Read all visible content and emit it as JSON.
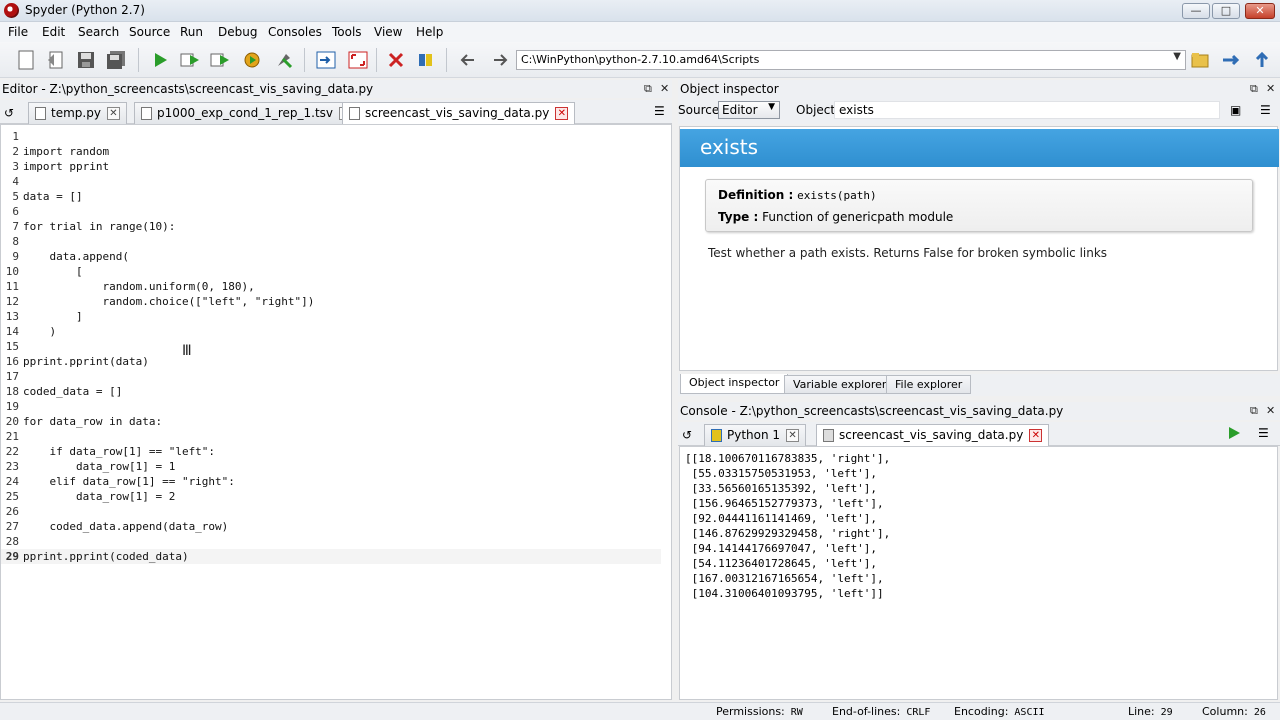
{
  "window": {
    "title": "Spyder (Python 2.7)"
  },
  "menu": [
    "File",
    "Edit",
    "Search",
    "Source",
    "Run",
    "Debug",
    "Consoles",
    "Tools",
    "View",
    "Help"
  ],
  "toolbar": {
    "path": "C:\\WinPython\\python-2.7.10.amd64\\Scripts"
  },
  "editor": {
    "header": "Editor - Z:\\python_screencasts\\screencast_vis_saving_data.py",
    "tabs": [
      "temp.py",
      "p1000_exp_cond_1_rep_1.tsv",
      "screencast_vis_saving_data.py"
    ],
    "active_tab": 2,
    "lines": [
      {
        "n": "1",
        "text": ""
      },
      {
        "n": "2",
        "text": "import random"
      },
      {
        "n": "3",
        "text": "import pprint"
      },
      {
        "n": "4",
        "text": ""
      },
      {
        "n": "5",
        "text": "data = []"
      },
      {
        "n": "6",
        "text": ""
      },
      {
        "n": "7",
        "text": "for trial in range(10):"
      },
      {
        "n": "8",
        "text": ""
      },
      {
        "n": "9",
        "text": "    data.append("
      },
      {
        "n": "10",
        "text": "        ["
      },
      {
        "n": "11",
        "text": "            random.uniform(0, 180),"
      },
      {
        "n": "12",
        "text": "            random.choice([\"left\", \"right\"])"
      },
      {
        "n": "13",
        "text": "        ]"
      },
      {
        "n": "14",
        "text": "    )"
      },
      {
        "n": "15",
        "text": ""
      },
      {
        "n": "16",
        "text": "pprint.pprint(data)"
      },
      {
        "n": "17",
        "text": ""
      },
      {
        "n": "18",
        "text": "coded_data = []"
      },
      {
        "n": "19",
        "text": ""
      },
      {
        "n": "20",
        "text": "for data_row in data:"
      },
      {
        "n": "21",
        "text": ""
      },
      {
        "n": "22",
        "text": "    if data_row[1] == \"left\":"
      },
      {
        "n": "23",
        "text": "        data_row[1] = 1"
      },
      {
        "n": "24",
        "text": "    elif data_row[1] == \"right\":"
      },
      {
        "n": "25",
        "text": "        data_row[1] = 2"
      },
      {
        "n": "26",
        "text": ""
      },
      {
        "n": "27",
        "text": "    coded_data.append(data_row)"
      },
      {
        "n": "28",
        "text": ""
      },
      {
        "n": "29",
        "text": "pprint.pprint(coded_data)"
      }
    ]
  },
  "inspector": {
    "header": "Object inspector",
    "source_label": "Source",
    "source_value": "Editor",
    "object_label": "Object",
    "object_value": "exists",
    "title": "exists",
    "def_label": "Definition :",
    "def_value": "exists(path)",
    "type_label": "Type :",
    "type_value": "Function of genericpath module",
    "description": "Test whether a path exists. Returns False for broken symbolic links",
    "bottom_tabs": [
      "Object inspector",
      "Variable explorer",
      "File explorer"
    ]
  },
  "console": {
    "header": "Console - Z:\\python_screencasts\\screencast_vis_saving_data.py",
    "tabs": [
      "Python 1",
      "screencast_vis_saving_data.py"
    ],
    "output": [
      "[[18.100670116783835, 'right'],",
      " [55.03315750531953, 'left'],",
      " [33.56560165135392, 'left'],",
      " [156.96465152779373, 'left'],",
      " [92.04441161141469, 'left'],",
      " [146.87629929329458, 'right'],",
      " [94.14144176697047, 'left'],",
      " [54.11236401728645, 'left'],",
      " [167.00312167165654, 'left'],",
      " [104.31006401093795, 'left']]"
    ]
  },
  "status": {
    "permissions_label": "Permissions:",
    "permissions_value": "RW",
    "eol_label": "End-of-lines:",
    "eol_value": "CRLF",
    "encoding_label": "Encoding:",
    "encoding_value": "ASCII",
    "line_label": "Line:",
    "line_value": "29",
    "column_label": "Column:",
    "column_value": "26"
  }
}
